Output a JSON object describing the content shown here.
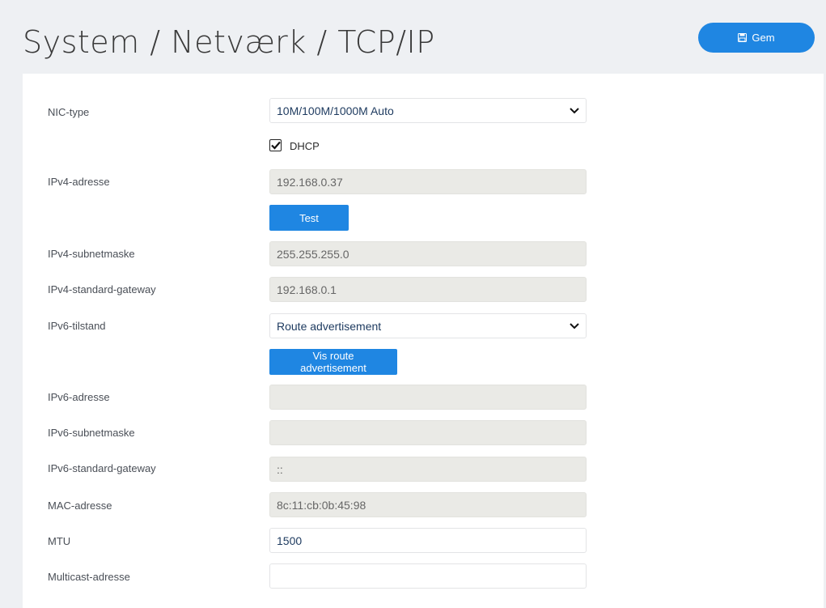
{
  "header": {
    "title": "System / Netværk / TCP/IP",
    "save_label": "Gem",
    "save_icon": "floppy-disk-icon"
  },
  "form": {
    "nic_type": {
      "label": "NIC-type",
      "value": "10M/100M/1000M Auto"
    },
    "dhcp": {
      "label": "DHCP",
      "checked": true
    },
    "ipv4_address": {
      "label": "IPv4-adresse",
      "value": "192.168.0.37",
      "test_label": "Test"
    },
    "ipv4_subnet": {
      "label": "IPv4-subnetmaske",
      "value": "255.255.255.0"
    },
    "ipv4_gateway": {
      "label": "IPv4-standard-gateway",
      "value": "192.168.0.1"
    },
    "ipv6_mode": {
      "label": "IPv6-tilstand",
      "value": "Route advertisement",
      "button_label": "Vis route advertisement"
    },
    "ipv6_address": {
      "label": "IPv6-adresse",
      "value": ""
    },
    "ipv6_subnet": {
      "label": "IPv6-subnetmaske",
      "value": ""
    },
    "ipv6_gateway": {
      "label": "IPv6-standard-gateway",
      "value": "::"
    },
    "mac_address": {
      "label": "MAC-adresse",
      "value": "8c:11:cb:0b:45:98"
    },
    "mtu": {
      "label": "MTU",
      "value": "1500"
    },
    "multicast": {
      "label": "Multicast-adresse",
      "value": ""
    }
  },
  "colors": {
    "accent": "#1f86e2",
    "readonly_bg": "#eaeae6",
    "page_bg": "#eef0f3"
  }
}
